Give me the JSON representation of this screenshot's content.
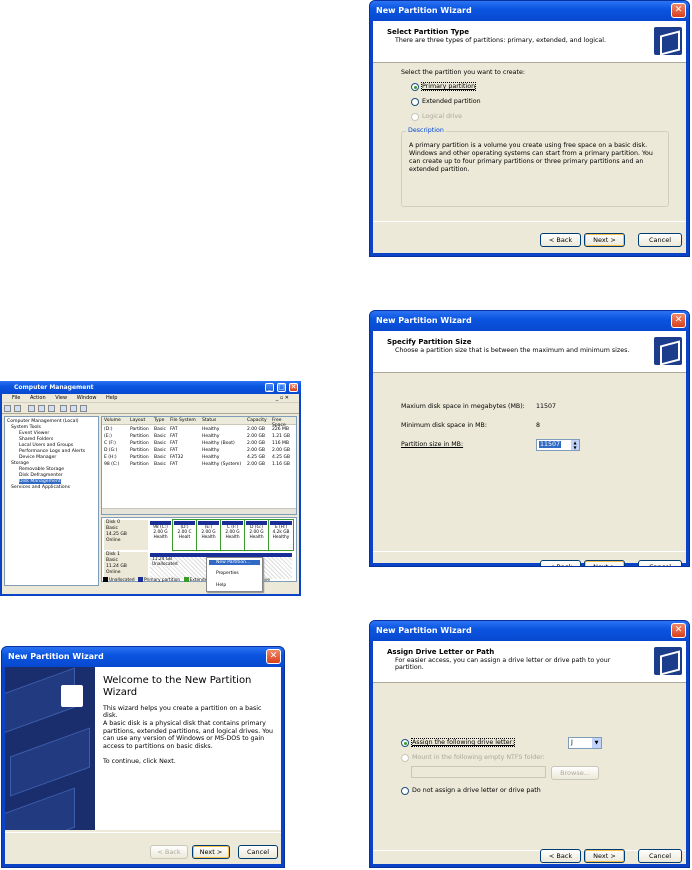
{
  "windows": {
    "title": "New Partition Wizard",
    "close_glyph": "✕"
  },
  "select_type": {
    "header": "Select Partition Type",
    "subheader": "There are three types of partitions: primary, extended, and logical.",
    "prompt": "Select the partition you want to create:",
    "options": [
      "Primary partition",
      "Extended partition",
      "Logical drive"
    ],
    "description_label": "Description",
    "description": "A primary partition is a volume you create using free space on a basic disk. Windows and other operating systems can start from a primary partition. You can create up to four primary partitions or three primary partitions and an extended partition."
  },
  "partition_size": {
    "header": "Specify Partition Size",
    "subheader": "Choose a partition size that is between the maximum and minimum sizes.",
    "max_label": "Maxium disk space in megabytes (MB):",
    "max_value": "11507",
    "min_label": "Minimum disk space in MB:",
    "min_value": "8",
    "size_label": "Partition size in MB:",
    "size_value": "11507"
  },
  "drive_letter": {
    "header": "Assign Drive Letter or Path",
    "subheader": "For easier access, you can assign a drive letter or drive path to your partition.",
    "option_assign": "Assign the following drive letter:",
    "letter_value": "J",
    "option_mount": "Mount in the following empty NTFS folder:",
    "browse_label": "Browse...",
    "option_none": "Do not assign a drive letter or drive path"
  },
  "welcome": {
    "heading": "Welcome to the New Partition Wizard",
    "line1": "This wizard helps you create a partition on a basic disk.",
    "line2": "A basic disk is a physical disk that contains primary partitions, extended partitions, and logical drives. You can use any version of Windows or MS-DOS to gain access to partitions on basic disks.",
    "line3": "To continue, click Next."
  },
  "buttons": {
    "back": "< Back",
    "next": "Next >",
    "cancel": "Cancel"
  },
  "computer_management": {
    "title": "Computer Management",
    "menu": [
      "File",
      "Action",
      "View",
      "Window",
      "Help"
    ],
    "win_controls": [
      "_",
      "□",
      "✕"
    ],
    "inner_controls": "_ ▫ ✕",
    "tree": [
      "Computer Management (Local)",
      "System Tools",
      "Event Viewer",
      "Shared Folders",
      "Local Users and Groups",
      "Performance Logs and Alerts",
      "Device Manager",
      "Storage",
      "Removable Storage",
      "Disk Defragmenter",
      "Disk Management",
      "Services and Applications"
    ],
    "columns": [
      "Volume",
      "Layout",
      "Type",
      "File System",
      "Status",
      "Capacity",
      "Free Space"
    ],
    "rows": [
      [
        "(D:)",
        "Partition",
        "Basic",
        "FAT",
        "Healthy",
        "2.00 GB",
        "226 MB"
      ],
      [
        "(E:)",
        "Partition",
        "Basic",
        "FAT",
        "Healthy",
        "2.00 GB",
        "1.21 GB"
      ],
      [
        "C (F:)",
        "Partition",
        "Basic",
        "FAT",
        "Healthy (Boot)",
        "2.00 GB",
        "116 MB"
      ],
      [
        "D (G:)",
        "Partition",
        "Basic",
        "FAT",
        "Healthy",
        "2.00 GB",
        "2.00 GB"
      ],
      [
        "E (H:)",
        "Partition",
        "Basic",
        "FAT32",
        "Healthy",
        "4.25 GB",
        "4.25 GB"
      ],
      [
        "98 (C:)",
        "Partition",
        "Basic",
        "FAT",
        "Healthy (System)",
        "2.00 GB",
        "1.16 GB"
      ]
    ],
    "disk0_label": "Disk 0\nBasic\n14.25 GB\nOnline",
    "disk0_parts": [
      "98 (C:)\n2.00 G\nHealth",
      "(D:)\n2.00 C\nHealt",
      "(E:)\n2.00 G\nHealth",
      "C (F:)\n2.00 G\nHealth",
      "D (G:)\n2.00 G\nHealth",
      "E (H:)\n4.2k GB\nHealthy"
    ],
    "disk1_label": "Disk 1\nBasic\n11.24 GB\nOnline",
    "disk1_part": "11.24 GB\nUnallocated",
    "context_menu": [
      "New Partition...",
      "Properties",
      "Help"
    ],
    "legend": [
      "Unallocated",
      "Primary partition",
      "Extende",
      "ive"
    ]
  }
}
